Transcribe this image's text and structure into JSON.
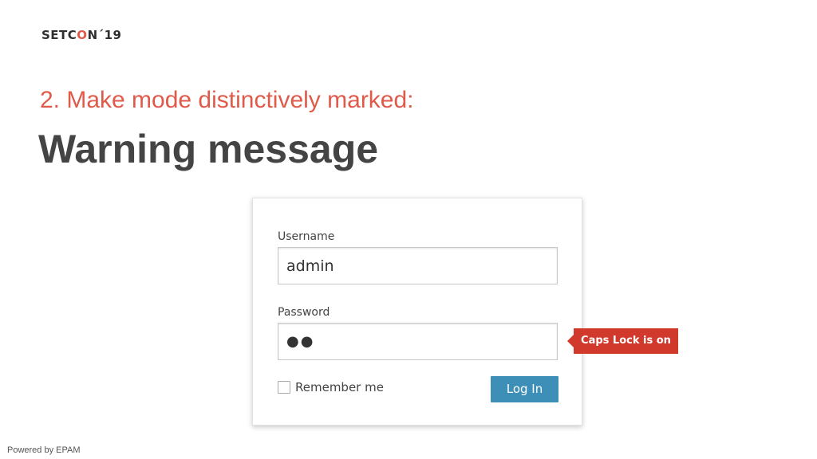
{
  "slide": {
    "logo": {
      "part1": "SETC",
      "part2": "O",
      "part3": "N",
      "year": "´19"
    },
    "subtitle": "2. Make mode distinctively marked:",
    "title": "Warning message",
    "footer": "Powered by EPAM"
  },
  "login_form": {
    "username_label": "Username",
    "username_value": "admin",
    "password_label": "Password",
    "password_masked": "●●",
    "remember_label": "Remember me",
    "remember_checked": false,
    "login_button_label": "Log In"
  },
  "caps_lock_warning": {
    "text": "Caps Lock is on"
  },
  "colors": {
    "accent": "#e05a4a",
    "title_text": "#444444",
    "button_blue": "#3d8fb8",
    "warning_red": "#d0392b"
  }
}
